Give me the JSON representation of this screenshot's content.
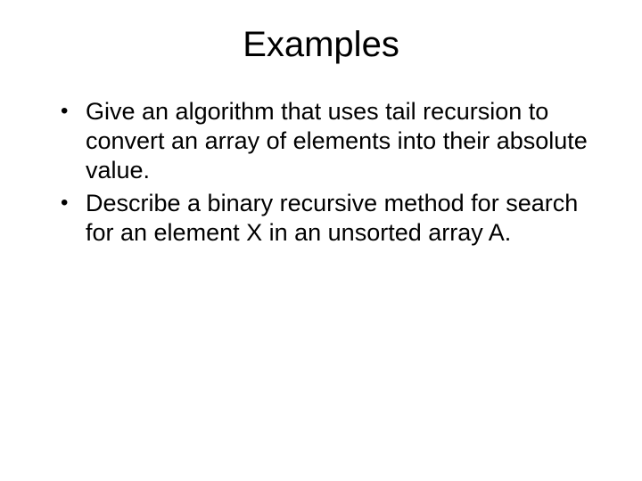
{
  "title": "Examples",
  "bullets": [
    "Give an algorithm that uses tail recursion to convert an array of elements into their absolute value.",
    "Describe a binary recursive method for search for an element X in an unsorted array A."
  ]
}
